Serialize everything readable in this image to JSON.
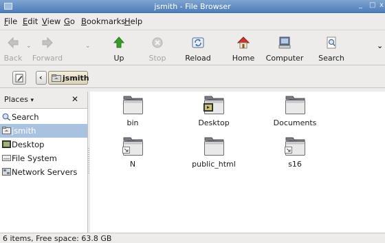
{
  "window": {
    "title": "jsmith - File Browser",
    "minimize": "_",
    "maximize": "□",
    "close": "x"
  },
  "menu": [
    "File",
    "Edit",
    "View",
    "Go",
    "Bookmarks",
    "Help"
  ],
  "menu_mnemonics": [
    "F",
    "E",
    "V",
    "G",
    "B",
    "H"
  ],
  "toolbar": {
    "back": "Back",
    "forward": "Forward",
    "up": "Up",
    "stop": "Stop",
    "reload": "Reload",
    "home": "Home",
    "computer": "Computer",
    "search": "Search"
  },
  "location": {
    "current": "jsmith"
  },
  "sidebar": {
    "header": "Places",
    "close": "✕",
    "items": [
      {
        "label": "Search",
        "icon": "search-icon"
      },
      {
        "label": "jsmith",
        "icon": "home-folder-icon",
        "selected": true
      },
      {
        "label": "Desktop",
        "icon": "desktop-icon"
      },
      {
        "label": "File System",
        "icon": "drive-icon"
      },
      {
        "label": "Network Servers",
        "icon": "network-icon"
      }
    ]
  },
  "files": [
    {
      "name": "bin",
      "icon": "folder-icon"
    },
    {
      "name": "Desktop",
      "icon": "desktop-folder-icon"
    },
    {
      "name": "Documents",
      "icon": "folder-icon"
    },
    {
      "name": "N",
      "icon": "folder-link-icon"
    },
    {
      "name": "public_html",
      "icon": "folder-icon"
    },
    {
      "name": "s16",
      "icon": "folder-link-icon"
    }
  ],
  "status": {
    "text": "6 items, Free space: 63.8 GB"
  },
  "colors": {
    "titlebar": "#4f7dbb",
    "selection": "#a8c2e0",
    "up_arrow": "#3a9a2a",
    "home_roof": "#c8352b"
  }
}
